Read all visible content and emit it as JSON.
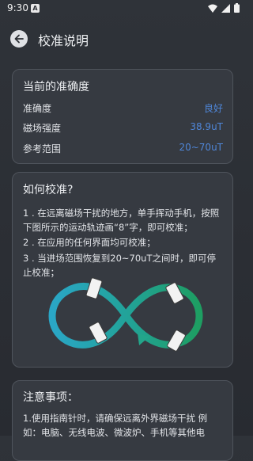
{
  "status_bar": {
    "time": "9:30",
    "notification_glyph": "A"
  },
  "header": {
    "title": "校准说明"
  },
  "accuracy_card": {
    "title": "当前的准确度",
    "rows": [
      {
        "label": "准确度",
        "value": "良好"
      },
      {
        "label": "磁场强度",
        "value": "38.9uT"
      },
      {
        "label": "参考范围",
        "value": "20~70uT"
      }
    ]
  },
  "howto_card": {
    "title": "如何校准?",
    "steps": [
      "1 . 在远离磁场干扰的地方，单手挥动手机，按照下图所示的运动轨迹画“8”字，即可校准；",
      "2 . 在应用的任何界面均可校准；",
      "3 . 当进场范围恢复到20~70uT之间时，即可停止校准；"
    ]
  },
  "notes_card": {
    "title": "注意事项：",
    "text": "1.使用指南针时，请确保远离外界磁场干扰 例如：电脑、无线电波、微波炉、手机等其他电"
  },
  "colors": {
    "accent_value": "#4f86d8",
    "figure8_blue": "#2aa6c6",
    "figure8_green": "#1e9e62"
  },
  "icons": [
    "back-arrow-icon",
    "signal-icon",
    "wifi-icon",
    "battery-icon",
    "phone-icon",
    "direction-arrow-icon"
  ]
}
